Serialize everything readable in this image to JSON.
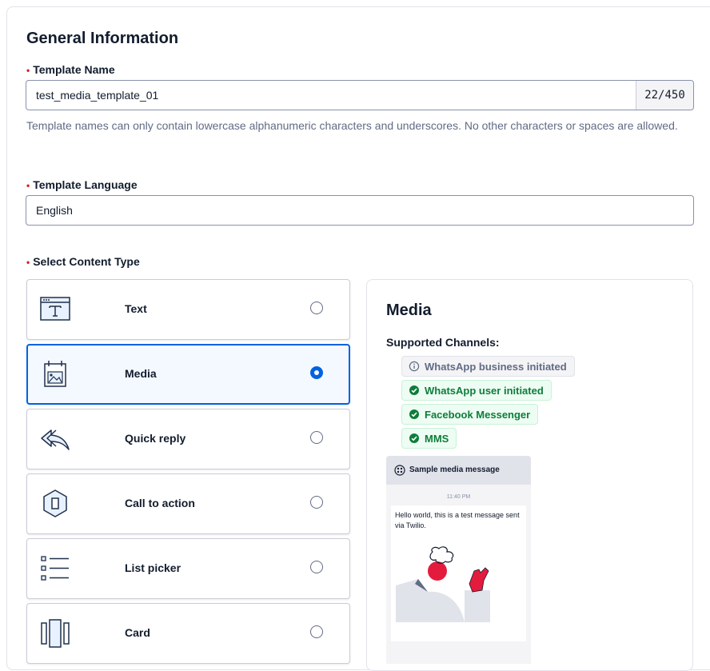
{
  "general": {
    "title": "General Information",
    "required_marker": "•",
    "template_name": {
      "label": "Template Name",
      "value": "test_media_template_01",
      "counter": "22/450",
      "help": "Template names can only contain lowercase alphanumeric characters and underscores. No other characters or spaces are allowed."
    },
    "template_language": {
      "label": "Template Language",
      "value": "English"
    },
    "content_type": {
      "label": "Select Content Type",
      "options": [
        {
          "label": "Text",
          "icon": "text-template-icon",
          "selected": false
        },
        {
          "label": "Media",
          "icon": "media-template-icon",
          "selected": true
        },
        {
          "label": "Quick reply",
          "icon": "quick-reply-icon",
          "selected": false
        },
        {
          "label": "Call to action",
          "icon": "call-to-action-icon",
          "selected": false
        },
        {
          "label": "List picker",
          "icon": "list-picker-icon",
          "selected": false
        },
        {
          "label": "Card",
          "icon": "card-icon",
          "selected": false
        }
      ]
    }
  },
  "preview": {
    "title": "Media",
    "channels_label": "Supported Channels:",
    "channels": [
      {
        "label": "WhatsApp business initiated",
        "status": "info"
      },
      {
        "label": "WhatsApp user initiated",
        "status": "supported"
      },
      {
        "label": "Facebook Messenger",
        "status": "supported"
      },
      {
        "label": "MMS",
        "status": "supported"
      }
    ],
    "sample": {
      "header": "Sample media message",
      "time": "11:40 PM",
      "message": "Hello world, this is a test message sent via Twilio."
    }
  },
  "colors": {
    "primary": "#0263e0",
    "success": "#0e7c3a",
    "required": "#d61f1f",
    "accent_red": "#e31c3d"
  }
}
